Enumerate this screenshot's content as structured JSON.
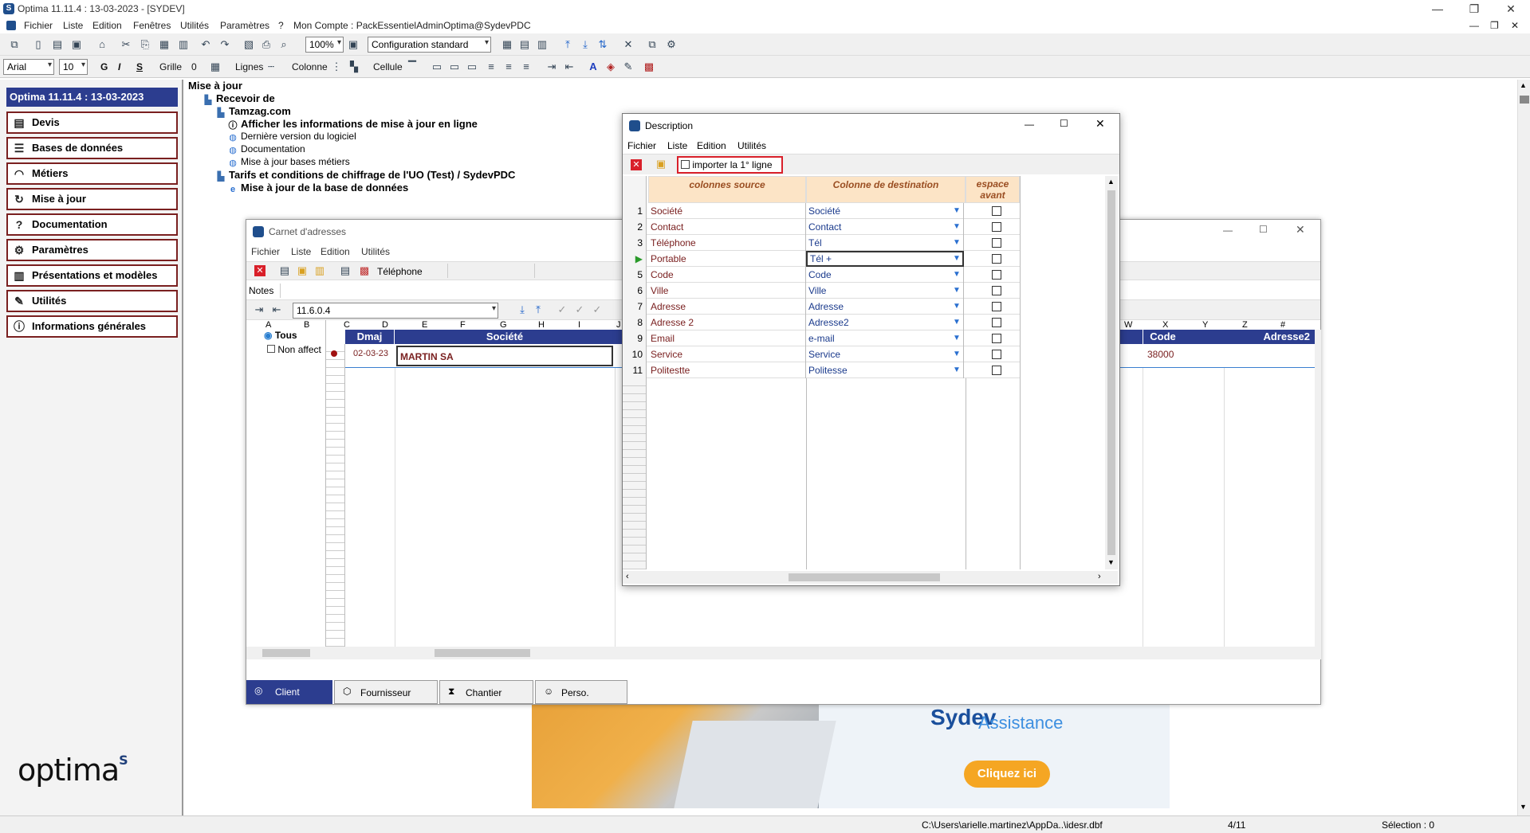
{
  "app": {
    "title": "Optima 11.11.4 : 13-03-2023 - [SYDEV]",
    "window_controls": [
      "—",
      "❐",
      "✕"
    ],
    "mdi_controls": [
      "—",
      "❐",
      "✕"
    ]
  },
  "menubar": {
    "items": [
      "Fichier",
      "Liste",
      "Edition",
      "Fenêtres",
      "Utilités",
      "Paramètres",
      "?",
      "Mon Compte : PackEssentielAdminOptima@SydevPDC"
    ]
  },
  "toolbar": {
    "zoom": "100%",
    "config": "Configuration standard"
  },
  "formatbar": {
    "font": "Arial",
    "size": "10",
    "bold": "G",
    "italic": "I",
    "shadow": "S",
    "grille": "Grille",
    "grille_value": "0",
    "lignes": "Lignes",
    "colonne": "Colonne",
    "cellule": "Cellule"
  },
  "sidebar": {
    "header": "Optima 11.11.4 : 13-03-2023",
    "items": [
      {
        "label": "Devis",
        "icon": "document-icon"
      },
      {
        "label": "Bases de données",
        "icon": "database-icon"
      },
      {
        "label": "Métiers",
        "icon": "helmet-icon"
      },
      {
        "label": "Mise à jour",
        "icon": "refresh-icon"
      },
      {
        "label": "Documentation",
        "icon": "help-icon"
      },
      {
        "label": "Paramètres",
        "icon": "gear-icon"
      },
      {
        "label": "Présentations et modèles",
        "icon": "binder-icon"
      },
      {
        "label": "Utilités",
        "icon": "wrench-icon"
      },
      {
        "label": "Informations générales",
        "icon": "info-icon"
      }
    ],
    "logo": "optima"
  },
  "tree": {
    "root": "Mise à jour",
    "recevoir": "Recevoir de",
    "tamzag": "Tamzag.com",
    "afficher": "Afficher les informations de mise à jour en ligne",
    "derniere": "Dernière version du logiciel",
    "documentation": "Documentation",
    "bases_metiers": "Mise à jour bases métiers",
    "tarifs": "Tarifs et conditions de chiffrage de l'UO (Test) / SydevPDC",
    "mise_bd": "Mise à jour de la base de données"
  },
  "carnet": {
    "title": "Carnet d'adresses",
    "menu": [
      "Fichier",
      "Liste",
      "Edition",
      "Utilités"
    ],
    "telephone_label": "Téléphone",
    "notes_label": "Notes",
    "version_combo": "11.6.0.4",
    "filters": {
      "tous": "Tous",
      "non_affect": "Non affect"
    },
    "col_letters": [
      "A",
      "B",
      "C",
      "D",
      "E",
      "F",
      "G",
      "H",
      "I",
      "J",
      "W",
      "X",
      "Y",
      "Z",
      "#"
    ],
    "headers": {
      "dmaj": "Dmaj",
      "societe": "Société",
      "code": "Code",
      "adresse2": "Adresse2"
    },
    "row": {
      "dmaj": "02-03-23",
      "societe": "MARTIN SA",
      "code": "38000"
    },
    "tabs": [
      "Client",
      "Fournisseur",
      "Chantier",
      "Perso."
    ]
  },
  "description": {
    "title": "Description",
    "menu": [
      "Fichier",
      "Liste",
      "Edition",
      "Utilités"
    ],
    "import_first_line": "importer la 1° ligne",
    "headers": {
      "source": "colonnes source",
      "destination": "Colonne de destination",
      "espace": "espace avant"
    },
    "rows": [
      {
        "n": "1",
        "src": "Société",
        "dst": "Société"
      },
      {
        "n": "2",
        "src": "Contact",
        "dst": "Contact"
      },
      {
        "n": "3",
        "src": "Téléphone",
        "dst": "Tél"
      },
      {
        "n": "",
        "src": "Portable",
        "dst": "Tél +"
      },
      {
        "n": "5",
        "src": "Code",
        "dst": "Code"
      },
      {
        "n": "6",
        "src": "Ville",
        "dst": "Ville"
      },
      {
        "n": "7",
        "src": "Adresse",
        "dst": "Adresse"
      },
      {
        "n": "8",
        "src": "Adresse 2",
        "dst": "Adresse2"
      },
      {
        "n": "9",
        "src": "Email",
        "dst": "e-mail"
      },
      {
        "n": "10",
        "src": "Service",
        "dst": "Service"
      },
      {
        "n": "11",
        "src": "Politestte",
        "dst": "Politesse"
      }
    ]
  },
  "ad": {
    "brand": "Sydev",
    "subtitle": "Assistance",
    "cta": "Cliquez ici"
  },
  "status": {
    "path": "C:\\Users\\arielle.martinez\\AppDa..\\idesr.dbf",
    "count": "4/11",
    "selection": "Sélection : 0"
  },
  "colors": {
    "navy": "#2c3d8f",
    "maroon": "#7a2020",
    "peach": "#fce4c6",
    "cta": "#f5a623",
    "highlight_red": "#d9202a"
  }
}
